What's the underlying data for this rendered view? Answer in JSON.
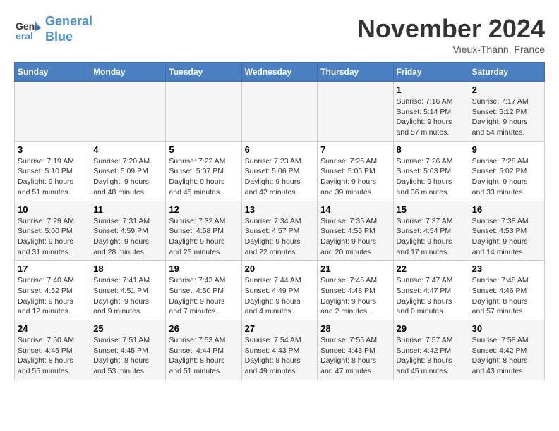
{
  "logo": {
    "line1": "General",
    "line2": "Blue"
  },
  "title": "November 2024",
  "subtitle": "Vieux-Thann, France",
  "days_of_week": [
    "Sunday",
    "Monday",
    "Tuesday",
    "Wednesday",
    "Thursday",
    "Friday",
    "Saturday"
  ],
  "weeks": [
    [
      {
        "day": "",
        "info": ""
      },
      {
        "day": "",
        "info": ""
      },
      {
        "day": "",
        "info": ""
      },
      {
        "day": "",
        "info": ""
      },
      {
        "day": "",
        "info": ""
      },
      {
        "day": "1",
        "info": "Sunrise: 7:16 AM\nSunset: 5:14 PM\nDaylight: 9 hours and 57 minutes."
      },
      {
        "day": "2",
        "info": "Sunrise: 7:17 AM\nSunset: 5:12 PM\nDaylight: 9 hours and 54 minutes."
      }
    ],
    [
      {
        "day": "3",
        "info": "Sunrise: 7:19 AM\nSunset: 5:10 PM\nDaylight: 9 hours and 51 minutes."
      },
      {
        "day": "4",
        "info": "Sunrise: 7:20 AM\nSunset: 5:09 PM\nDaylight: 9 hours and 48 minutes."
      },
      {
        "day": "5",
        "info": "Sunrise: 7:22 AM\nSunset: 5:07 PM\nDaylight: 9 hours and 45 minutes."
      },
      {
        "day": "6",
        "info": "Sunrise: 7:23 AM\nSunset: 5:06 PM\nDaylight: 9 hours and 42 minutes."
      },
      {
        "day": "7",
        "info": "Sunrise: 7:25 AM\nSunset: 5:05 PM\nDaylight: 9 hours and 39 minutes."
      },
      {
        "day": "8",
        "info": "Sunrise: 7:26 AM\nSunset: 5:03 PM\nDaylight: 9 hours and 36 minutes."
      },
      {
        "day": "9",
        "info": "Sunrise: 7:28 AM\nSunset: 5:02 PM\nDaylight: 9 hours and 33 minutes."
      }
    ],
    [
      {
        "day": "10",
        "info": "Sunrise: 7:29 AM\nSunset: 5:00 PM\nDaylight: 9 hours and 31 minutes."
      },
      {
        "day": "11",
        "info": "Sunrise: 7:31 AM\nSunset: 4:59 PM\nDaylight: 9 hours and 28 minutes."
      },
      {
        "day": "12",
        "info": "Sunrise: 7:32 AM\nSunset: 4:58 PM\nDaylight: 9 hours and 25 minutes."
      },
      {
        "day": "13",
        "info": "Sunrise: 7:34 AM\nSunset: 4:57 PM\nDaylight: 9 hours and 22 minutes."
      },
      {
        "day": "14",
        "info": "Sunrise: 7:35 AM\nSunset: 4:55 PM\nDaylight: 9 hours and 20 minutes."
      },
      {
        "day": "15",
        "info": "Sunrise: 7:37 AM\nSunset: 4:54 PM\nDaylight: 9 hours and 17 minutes."
      },
      {
        "day": "16",
        "info": "Sunrise: 7:38 AM\nSunset: 4:53 PM\nDaylight: 9 hours and 14 minutes."
      }
    ],
    [
      {
        "day": "17",
        "info": "Sunrise: 7:40 AM\nSunset: 4:52 PM\nDaylight: 9 hours and 12 minutes."
      },
      {
        "day": "18",
        "info": "Sunrise: 7:41 AM\nSunset: 4:51 PM\nDaylight: 9 hours and 9 minutes."
      },
      {
        "day": "19",
        "info": "Sunrise: 7:43 AM\nSunset: 4:50 PM\nDaylight: 9 hours and 7 minutes."
      },
      {
        "day": "20",
        "info": "Sunrise: 7:44 AM\nSunset: 4:49 PM\nDaylight: 9 hours and 4 minutes."
      },
      {
        "day": "21",
        "info": "Sunrise: 7:46 AM\nSunset: 4:48 PM\nDaylight: 9 hours and 2 minutes."
      },
      {
        "day": "22",
        "info": "Sunrise: 7:47 AM\nSunset: 4:47 PM\nDaylight: 9 hours and 0 minutes."
      },
      {
        "day": "23",
        "info": "Sunrise: 7:48 AM\nSunset: 4:46 PM\nDaylight: 8 hours and 57 minutes."
      }
    ],
    [
      {
        "day": "24",
        "info": "Sunrise: 7:50 AM\nSunset: 4:45 PM\nDaylight: 8 hours and 55 minutes."
      },
      {
        "day": "25",
        "info": "Sunrise: 7:51 AM\nSunset: 4:45 PM\nDaylight: 8 hours and 53 minutes."
      },
      {
        "day": "26",
        "info": "Sunrise: 7:53 AM\nSunset: 4:44 PM\nDaylight: 8 hours and 51 minutes."
      },
      {
        "day": "27",
        "info": "Sunrise: 7:54 AM\nSunset: 4:43 PM\nDaylight: 8 hours and 49 minutes."
      },
      {
        "day": "28",
        "info": "Sunrise: 7:55 AM\nSunset: 4:43 PM\nDaylight: 8 hours and 47 minutes."
      },
      {
        "day": "29",
        "info": "Sunrise: 7:57 AM\nSunset: 4:42 PM\nDaylight: 8 hours and 45 minutes."
      },
      {
        "day": "30",
        "info": "Sunrise: 7:58 AM\nSunset: 4:42 PM\nDaylight: 8 hours and 43 minutes."
      }
    ]
  ]
}
